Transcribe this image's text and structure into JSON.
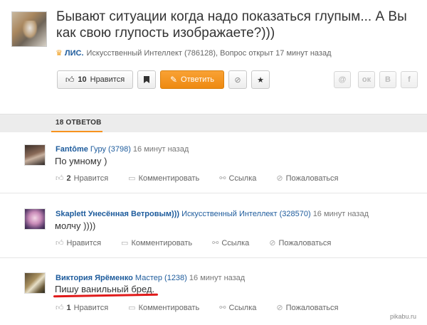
{
  "question": {
    "title": "Бывают ситуации когда надо показаться глупым... А Вы как свою глупость изображаете?)))",
    "author": "ЛИС.",
    "meta": "Искусственный Интеллект (786128), Вопрос открыт 17 минут назад"
  },
  "toolbar": {
    "like_count": "10",
    "like_label": "Нравится",
    "answer_label": "Ответить"
  },
  "share": {
    "mail": "@",
    "ok": "ок",
    "vk": "В",
    "fb": "f"
  },
  "answers_tab": "18 ОТВЕТОВ",
  "answers": [
    {
      "name": "Fantôme",
      "rank": "Гуру (3798)",
      "time": "16 минут назад",
      "text": "По умному )",
      "likes": "2",
      "like_label": "Нравится",
      "comment_label": "Комментировать",
      "link_label": "Ссылка",
      "report_label": "Пожаловаться"
    },
    {
      "name": "Skaplett Унесённая Ветровым)))",
      "rank": "Искусственный Интеллект (328570)",
      "time": "16 минут назад",
      "text": "молчу ))))",
      "likes": "",
      "like_label": "Нравится",
      "comment_label": "Комментировать",
      "link_label": "Ссылка",
      "report_label": "Пожаловаться"
    },
    {
      "name": "Виктория Ярёменко",
      "rank": "Мастер (1238)",
      "time": "16 минут назад",
      "text": "Пишу ванильный бред.",
      "likes": "1",
      "like_label": "Нравится",
      "comment_label": "Комментировать",
      "link_label": "Ссылка",
      "report_label": "Пожаловаться"
    }
  ],
  "watermark": "pikabu.ru",
  "colors": {
    "accent": "#f7931e",
    "link": "#1d5b9c",
    "highlight": "#e01a1a"
  }
}
